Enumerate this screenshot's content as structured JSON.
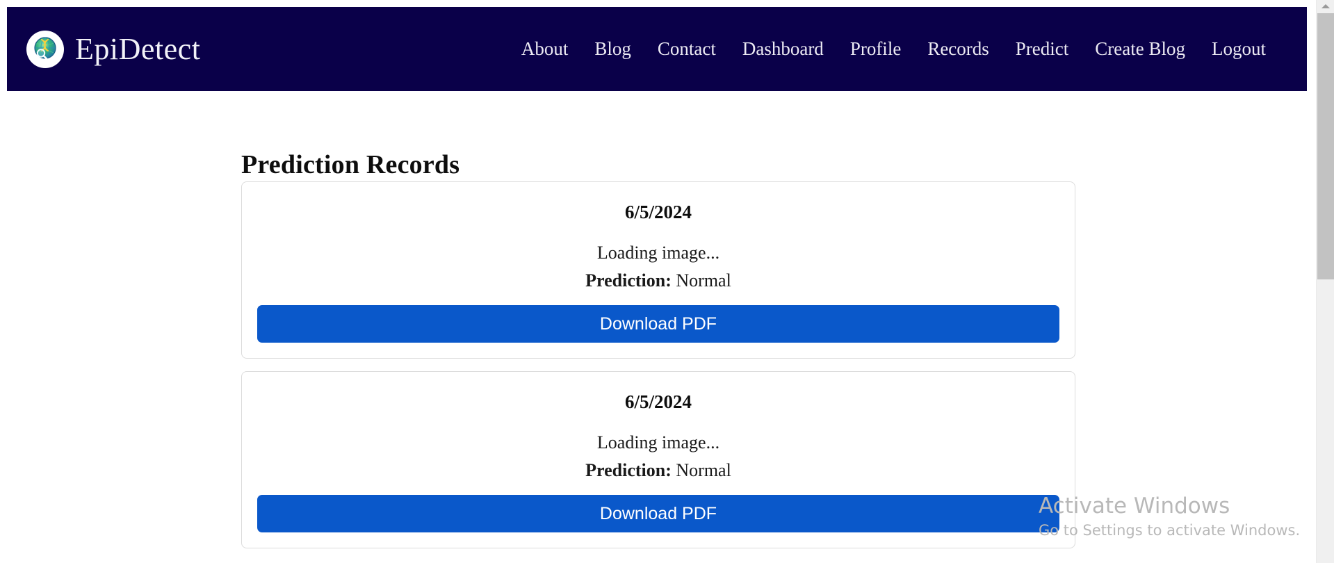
{
  "navbar": {
    "brand": {
      "name": "EpiDetect",
      "logo_icon": "dna-globe-magnifier-logo"
    },
    "background_color": "#0a0049",
    "links": [
      {
        "label": "About"
      },
      {
        "label": "Blog"
      },
      {
        "label": "Contact"
      },
      {
        "label": "Dashboard"
      },
      {
        "label": "Profile"
      },
      {
        "label": "Records"
      },
      {
        "label": "Predict"
      },
      {
        "label": "Create Blog"
      },
      {
        "label": "Logout"
      }
    ]
  },
  "main": {
    "page_title": "Prediction Records",
    "prediction_label": "Prediction:",
    "records": [
      {
        "date": "6/5/2024",
        "image_status": "Loading image...",
        "prediction_value": "Normal",
        "download_label": "Download PDF"
      },
      {
        "date": "6/5/2024",
        "image_status": "Loading image...",
        "prediction_value": "Normal",
        "download_label": "Download PDF"
      }
    ]
  },
  "watermark": {
    "title": "Activate Windows",
    "subtitle": "Go to Settings to activate Windows."
  },
  "colors": {
    "navy": "#0a0049",
    "button_blue": "#0a58ca",
    "card_border": "#dcdcdc",
    "scrollbar_thumb": "#c2c2c2"
  }
}
